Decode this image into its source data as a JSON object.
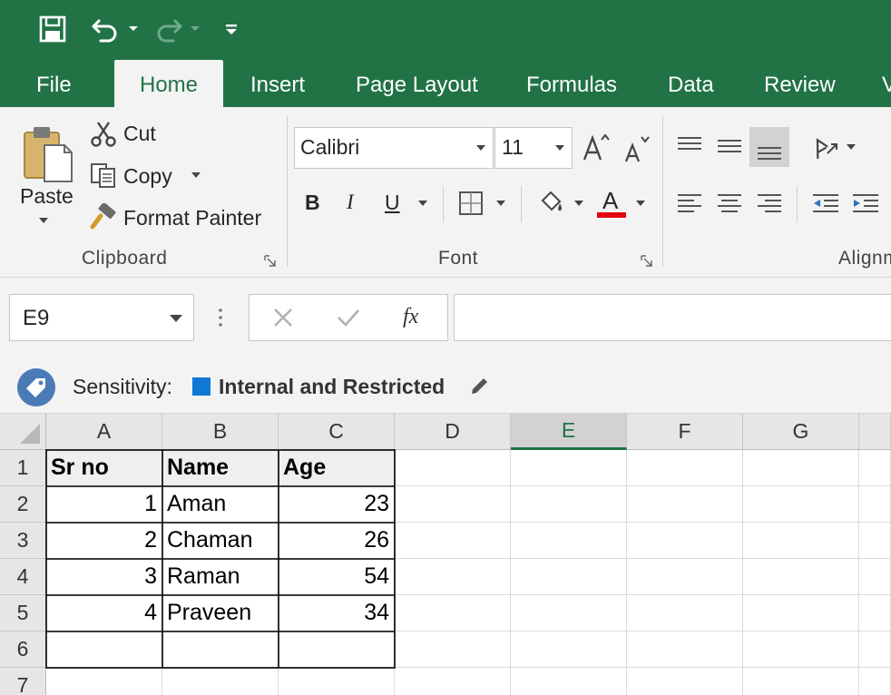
{
  "quick_access": {
    "save_icon": "save-icon",
    "undo_icon": "undo-icon",
    "redo_icon": "redo-icon",
    "customize_icon": "customize-qat-icon"
  },
  "tabs": [
    {
      "label": "File"
    },
    {
      "label": "Home"
    },
    {
      "label": "Insert"
    },
    {
      "label": "Page Layout"
    },
    {
      "label": "Formulas"
    },
    {
      "label": "Data"
    },
    {
      "label": "Review"
    },
    {
      "label": "V"
    }
  ],
  "clipboard": {
    "paste": "Paste",
    "cut": "Cut",
    "copy": "Copy",
    "format_painter": "Format Painter",
    "group_label": "Clipboard"
  },
  "font": {
    "family": "Calibri",
    "size": "11",
    "bold": "B",
    "italic": "I",
    "underline": "U",
    "font_color_letter": "A",
    "font_color": "#e3000f",
    "group_label": "Font"
  },
  "alignment": {
    "group_label": "Alignm"
  },
  "formula_bar": {
    "name_box": "E9",
    "fx": "fx",
    "formula": ""
  },
  "sensitivity": {
    "label": "Sensitivity:",
    "value": "Internal and Restricted",
    "swatch_color": "#0f78d4"
  },
  "grid": {
    "columns": [
      "A",
      "B",
      "C",
      "D",
      "E",
      "F",
      "G"
    ],
    "selected_column": "E",
    "rows": [
      "1",
      "2",
      "3",
      "4",
      "5",
      "6",
      "7"
    ],
    "cells": [
      [
        "Sr no",
        "Name",
        "Age"
      ],
      [
        "1",
        "Aman",
        "23"
      ],
      [
        "2",
        "Chaman",
        "26"
      ],
      [
        "3",
        "Raman",
        "54"
      ],
      [
        "4",
        "Praveen",
        "34"
      ]
    ]
  },
  "colors": {
    "accent": "#217346",
    "ribbon_bg": "#f3f3f3"
  }
}
